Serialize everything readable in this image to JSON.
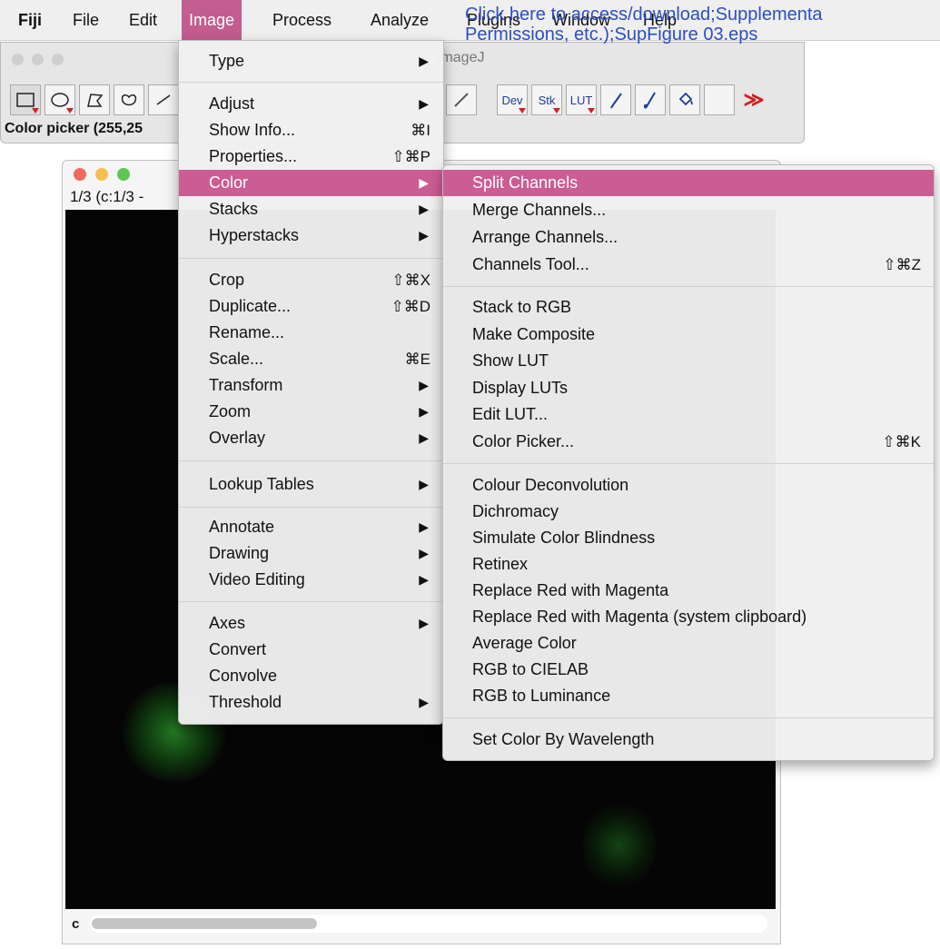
{
  "menubar": {
    "items": [
      "Fiji",
      "File",
      "Edit",
      "Image",
      "Process",
      "Analyze",
      "Plugins",
      "Window",
      "Help"
    ],
    "active": "Image"
  },
  "watermark": {
    "line1": "Click here to access/download;Supplementa",
    "line2": "Permissions, etc.);SupFigure 03.eps"
  },
  "imagej_window": {
    "title": "ImageJ",
    "status": "Color picker (255,25",
    "tools": [
      "rectangle-icon",
      "oval-icon",
      "polygon-icon",
      "freehand-icon"
    ],
    "right_tools": {
      "dev": "Dev",
      "stk": "Stk",
      "lut": "LUT",
      "more": "≫"
    }
  },
  "image_window": {
    "subtitle": "1/3 (c:1/3 -",
    "channel_label": "c"
  },
  "image_menu": {
    "items": [
      {
        "label": "Type",
        "submenu": true
      },
      {
        "label": "Adjust",
        "submenu": true
      },
      {
        "label": "Show Info...",
        "shortcut": "⌘I"
      },
      {
        "label": "Properties...",
        "shortcut": "⇧⌘P"
      },
      {
        "label": "Color",
        "submenu": true,
        "highlighted": true
      },
      {
        "label": "Stacks",
        "submenu": true
      },
      {
        "label": "Hyperstacks",
        "submenu": true
      },
      {
        "label": "Crop",
        "shortcut": "⇧⌘X"
      },
      {
        "label": "Duplicate...",
        "shortcut": "⇧⌘D"
      },
      {
        "label": "Rename..."
      },
      {
        "label": "Scale...",
        "shortcut": "⌘E"
      },
      {
        "label": "Transform",
        "submenu": true
      },
      {
        "label": "Zoom",
        "submenu": true
      },
      {
        "label": "Overlay",
        "submenu": true
      },
      {
        "label": "Lookup Tables",
        "submenu": true
      },
      {
        "label": "Annotate",
        "submenu": true
      },
      {
        "label": "Drawing",
        "submenu": true
      },
      {
        "label": "Video Editing",
        "submenu": true
      },
      {
        "label": "Axes",
        "submenu": true
      },
      {
        "label": "Convert"
      },
      {
        "label": "Convolve"
      },
      {
        "label": "Threshold",
        "submenu": true
      }
    ]
  },
  "color_menu": {
    "items": [
      {
        "label": "Split Channels",
        "highlighted": true
      },
      {
        "label": "Merge Channels..."
      },
      {
        "label": "Arrange Channels..."
      },
      {
        "label": "Channels Tool...",
        "shortcut": "⇧⌘Z"
      },
      {
        "label": "Stack to RGB"
      },
      {
        "label": "Make Composite"
      },
      {
        "label": "Show LUT"
      },
      {
        "label": "Display LUTs"
      },
      {
        "label": "Edit LUT..."
      },
      {
        "label": "Color Picker...",
        "shortcut": "⇧⌘K"
      },
      {
        "label": "Colour Deconvolution"
      },
      {
        "label": "Dichromacy"
      },
      {
        "label": "Simulate Color Blindness"
      },
      {
        "label": "Retinex"
      },
      {
        "label": "Replace Red with Magenta"
      },
      {
        "label": "Replace Red with Magenta (system clipboard)"
      },
      {
        "label": "Average Color"
      },
      {
        "label": "RGB to CIELAB"
      },
      {
        "label": "RGB to Luminance"
      },
      {
        "label": "Set Color By Wavelength"
      }
    ]
  },
  "colors": {
    "menu_highlight": "#cc5c94",
    "menubar_active": "#c35c8f",
    "watermark": "#2b4ec4"
  }
}
